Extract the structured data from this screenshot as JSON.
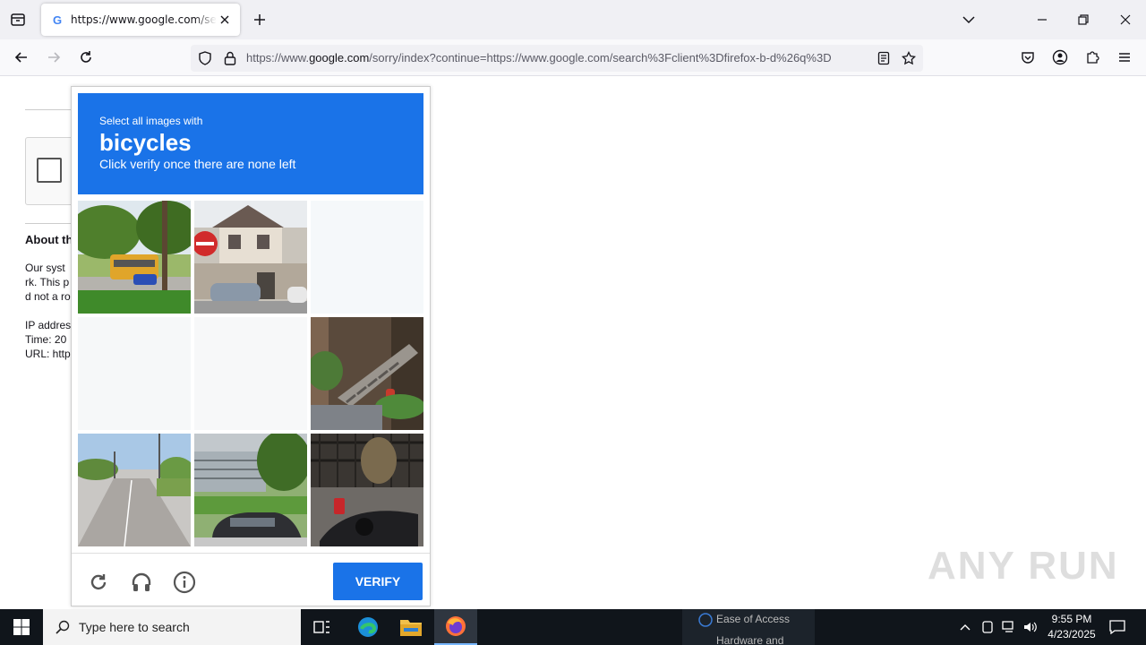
{
  "browser": {
    "tab": {
      "favicon": "google-g-icon",
      "title": "https://www.google.com/search?",
      "close": "close-icon"
    },
    "url": {
      "scheme": "https://www.",
      "domain": "google.com",
      "rest": "/sorry/index?continue=https://www.google.com/search%3Fclient%3Dfirefox-b-d%26q%3D"
    }
  },
  "page": {
    "about_heading": "About th",
    "paragraph_lines": [
      "Our syst",
      "rk. This p",
      "d not a ro"
    ],
    "ip_line": "IP addres",
    "time_line": "Time: 20",
    "url_line": "URL: http"
  },
  "captcha": {
    "instruction": "Select all images with",
    "target": "bicycles",
    "hint": "Click verify once there are none left",
    "tiles": [
      {
        "name": "tile-bus-street",
        "state": "image"
      },
      {
        "name": "tile-house-sign",
        "state": "image"
      },
      {
        "name": "tile-faded",
        "state": "fading"
      },
      {
        "name": "tile-faded",
        "state": "fading"
      },
      {
        "name": "tile-faded",
        "state": "fading"
      },
      {
        "name": "tile-stairs-hydrant",
        "state": "image"
      },
      {
        "name": "tile-road",
        "state": "image"
      },
      {
        "name": "tile-car-building",
        "state": "image"
      },
      {
        "name": "tile-motorbike",
        "state": "image"
      }
    ],
    "verify_label": "VERIFY",
    "accent": "#1a73e8"
  },
  "watermark": "ANY RUN",
  "taskbar": {
    "search_placeholder": "Type here to search",
    "peek_items": [
      "Ease of Access",
      "Hardware and"
    ],
    "time": "9:55 PM",
    "date": "4/23/2025"
  }
}
